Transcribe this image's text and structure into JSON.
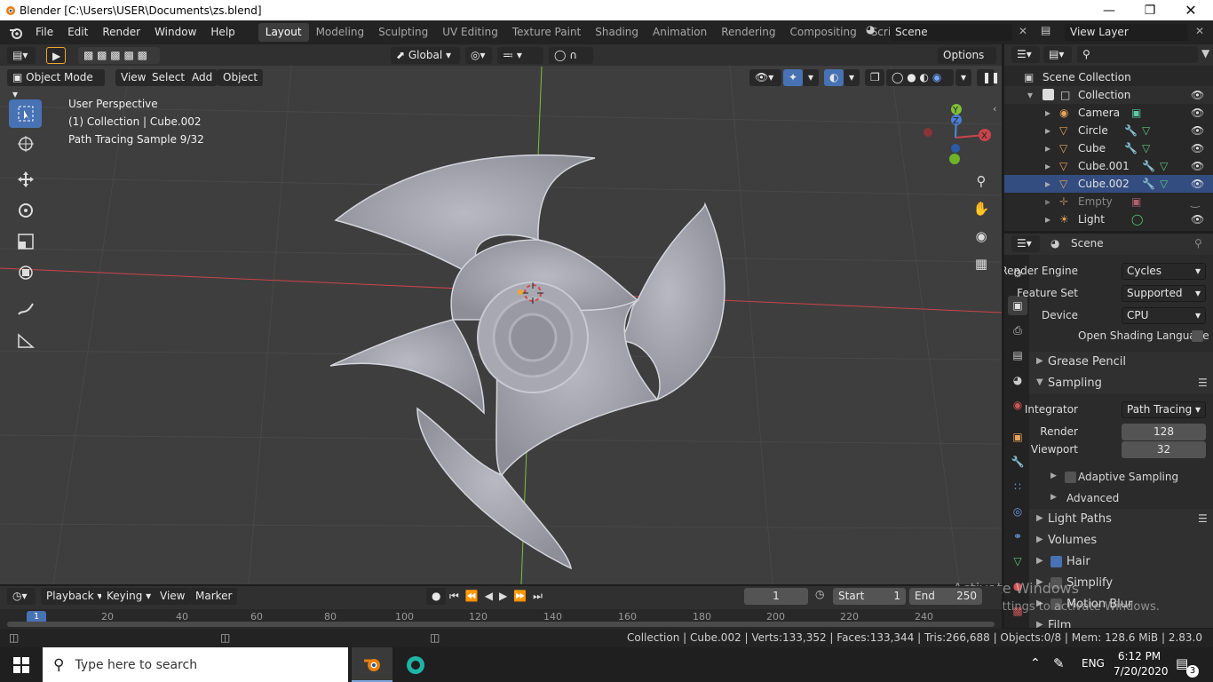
{
  "title": "Blender [C:\\Users\\USER\\Documents\\zs.blend]",
  "menus": [
    "File",
    "Edit",
    "Render",
    "Window",
    "Help"
  ],
  "workspaces": [
    "Layout",
    "Modeling",
    "Sculpting",
    "UV Editing",
    "Texture Paint",
    "Shading",
    "Animation",
    "Rendering",
    "Compositing",
    "Scripting"
  ],
  "active_workspace": "Layout",
  "scene_name": "Scene",
  "view_layer": "View Layer",
  "header": {
    "orientation": "Global",
    "options": "Options"
  },
  "viewport_header": {
    "mode": "Object Mode",
    "view": "View",
    "select": "Select",
    "add": "Add",
    "object": "Object"
  },
  "overlay_text": {
    "perspective": "User Perspective",
    "collection": "(1) Collection | Cube.002",
    "sample": "Path Tracing Sample 9/32"
  },
  "gizmo": {
    "x": "X",
    "y": "Y",
    "z": "Z"
  },
  "outliner": {
    "root": "Scene Collection",
    "collection": "Collection",
    "items": [
      "Camera",
      "Circle",
      "Cube",
      "Cube.001",
      "Cube.002",
      "Empty",
      "Light"
    ]
  },
  "properties": {
    "context": "Scene",
    "render_engine_label": "Render Engine",
    "render_engine": "Cycles",
    "feature_set_label": "Feature Set",
    "feature_set": "Supported",
    "device_label": "Device",
    "device": "CPU",
    "osl_label": "Open Shading Language",
    "grease_pencil": "Grease Pencil",
    "sampling": "Sampling",
    "integrator_label": "Integrator",
    "integrator": "Path Tracing",
    "render_label": "Render",
    "render_samples": "128",
    "viewport_label": "Viewport",
    "viewport_samples": "32",
    "adaptive": "Adaptive Sampling",
    "advanced": "Advanced",
    "light_paths": "Light Paths",
    "volumes": "Volumes",
    "hair": "Hair",
    "simplify": "Simplify",
    "motion_blur": "Motion Blur",
    "film": "Film"
  },
  "timeline": {
    "playback": "Playback",
    "keying": "Keying",
    "view": "View",
    "marker": "Marker",
    "frame": "1",
    "start_label": "Start",
    "start": "1",
    "end_label": "End",
    "end": "250",
    "ticks": [
      "1",
      "20",
      "40",
      "60",
      "80",
      "100",
      "120",
      "140",
      "160",
      "180",
      "200",
      "220",
      "240"
    ]
  },
  "watermark": {
    "line1": "Activate Windows",
    "line2": "Go to Settings to activate Windows."
  },
  "status": "Collection | Cube.002 | Verts:133,352 | Faces:133,344 | Tris:266,688 | Objects:0/8 | Mem: 128.6 MiB | 2.83.0",
  "taskbar": {
    "search": "Type here to search",
    "lang": "ENG",
    "time": "6:12 PM",
    "date": "7/20/2020",
    "notif": "3"
  },
  "colors": {
    "accent": "#4772b3",
    "x_axis": "#c9444b",
    "y_axis": "#7fbf3a",
    "bg": "#3e3e3e"
  }
}
